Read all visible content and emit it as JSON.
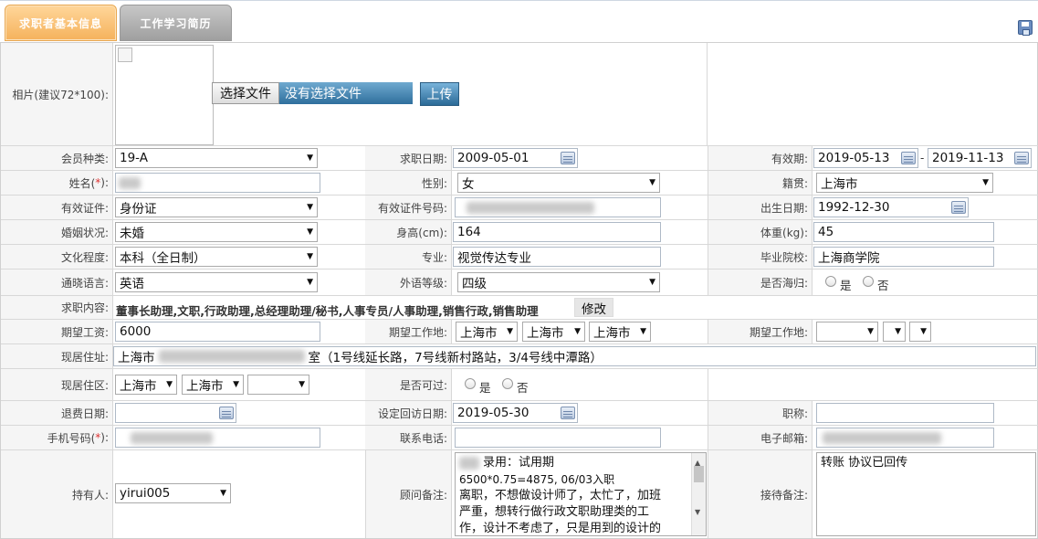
{
  "tabs": [
    "求职者基本信息",
    "工作学习简历"
  ],
  "photo": {
    "label": "相片(建议72*100):",
    "choose_button": "选择文件",
    "no_file": "没有选择文件",
    "upload_button": "上传"
  },
  "member_type": {
    "label": "会员种类:",
    "value": "19-A"
  },
  "job_date": {
    "label": "求职日期:",
    "value": "2009-05-01"
  },
  "validity": {
    "label": "有效期:",
    "start": "2019-05-13",
    "sep": "-",
    "end": "2019-11-13"
  },
  "name": {
    "label": "姓名(",
    "req": "*",
    "label_end": "):"
  },
  "gender": {
    "label": "性别:",
    "value": "女"
  },
  "native": {
    "label": "籍贯:",
    "value": "上海市"
  },
  "id_type": {
    "label": "有效证件:",
    "value": "身份证"
  },
  "id_number": {
    "label": "有效证件号码:"
  },
  "birth": {
    "label": "出生日期:",
    "value": "1992-12-30"
  },
  "marital": {
    "label": "婚姻状况:",
    "value": "未婚"
  },
  "height": {
    "label": "身高(cm):",
    "value": "164"
  },
  "weight": {
    "label": "体重(kg):",
    "value": "45"
  },
  "education": {
    "label": "文化程度:",
    "value": "本科（全日制）"
  },
  "major": {
    "label": "专业:",
    "value": "视觉传达专业"
  },
  "school": {
    "label": "毕业院校:",
    "value": "上海商学院"
  },
  "language": {
    "label": "通晓语言:",
    "value": "英语"
  },
  "language_level": {
    "label": "外语等级:",
    "value": "四级"
  },
  "returnee": {
    "label": "是否海归:",
    "yes": "是",
    "no": "否"
  },
  "job_content": {
    "label": "求职内容:",
    "value": "董事长助理,文职,行政助理,总经理助理/秘书,人事专员/人事助理,销售行政,销售助理",
    "edit_button": "修改"
  },
  "salary": {
    "label": "期望工资:",
    "value": "6000"
  },
  "expected_location": {
    "label": "期望工作地:",
    "a": "上海市",
    "b": "上海市",
    "c": "上海市"
  },
  "expected_location2": {
    "label": "期望工作地:"
  },
  "address": {
    "label": "现居住址:",
    "prefix": "上海市",
    "suffix": "室（1号线延长路，7号线新村路站，3/4号线中潭路）"
  },
  "district": {
    "label": "现居住区:",
    "a": "上海市",
    "b": "上海市"
  },
  "overnight": {
    "label": "是否可过:",
    "yes": "是",
    "no": "否"
  },
  "refund_date": {
    "label": "退费日期:"
  },
  "visit_date": {
    "label": "设定回访日期:",
    "value": "2019-05-30"
  },
  "title": {
    "label": "职称:"
  },
  "mobile": {
    "label": "手机号码(",
    "req": "*",
    "label_end": "):"
  },
  "phone": {
    "label": "联系电话:"
  },
  "email": {
    "label": "电子邮箱:"
  },
  "holder": {
    "label": "持有人:",
    "value": "yirui005"
  },
  "advisor_note": {
    "label": "顾问备注:",
    "lines": [
      "录用：试用期",
      "6500*0.75=4875, 06/03入职",
      "离职，不想做设计师了，太忙了，加班",
      "严重，想转行做行政文职助理类的工",
      "作，设计不考虑了，只是用到的设计的"
    ]
  },
  "reception_note": {
    "label": "接待备注:",
    "value": "转账 协议已回传"
  }
}
